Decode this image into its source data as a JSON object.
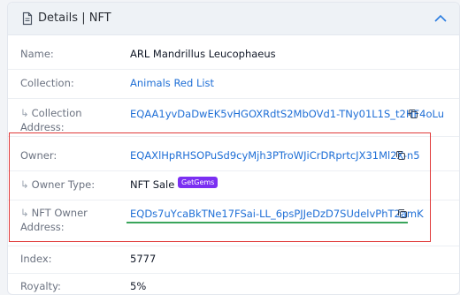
{
  "header": {
    "title": "Details | NFT",
    "icon": "document-icon",
    "toggle_icon": "chevron-up-icon"
  },
  "rows": [
    {
      "label": "Name:",
      "value": "ARL Mandrillus Leucophaeus"
    },
    {
      "label": "Collection:",
      "value": "Animals Red List"
    },
    {
      "label_line1": "Collection",
      "label_line2": "Address:",
      "value": "EQAA1yvDaDwEK5vHGOXRdtS2MbOVd1-TNy01L1S_t2HF4oLu"
    },
    {
      "label": "Owner:",
      "value": "EQAXlHpRHSOPuSd9cyMjh3PTroWJiCrDRprtcJX31Ml2X-n5"
    },
    {
      "label": "Owner Type:",
      "value": "NFT Sale",
      "badge": "GetGems"
    },
    {
      "label_line1": "NFT Owner",
      "label_line2": "Address:",
      "value": "EQDs7uYcaBkTNe17FSai-LL_6psPJJeDzD7SUdelvPhT2amK"
    },
    {
      "label": "Index:",
      "value": "5777"
    },
    {
      "label": "Royalty:",
      "value": "5%"
    }
  ],
  "colors": {
    "link": "#1f6fd6",
    "badge": "#7b2ff2",
    "highlight_box": "#e03a3a",
    "underline": "#3aa55b"
  }
}
